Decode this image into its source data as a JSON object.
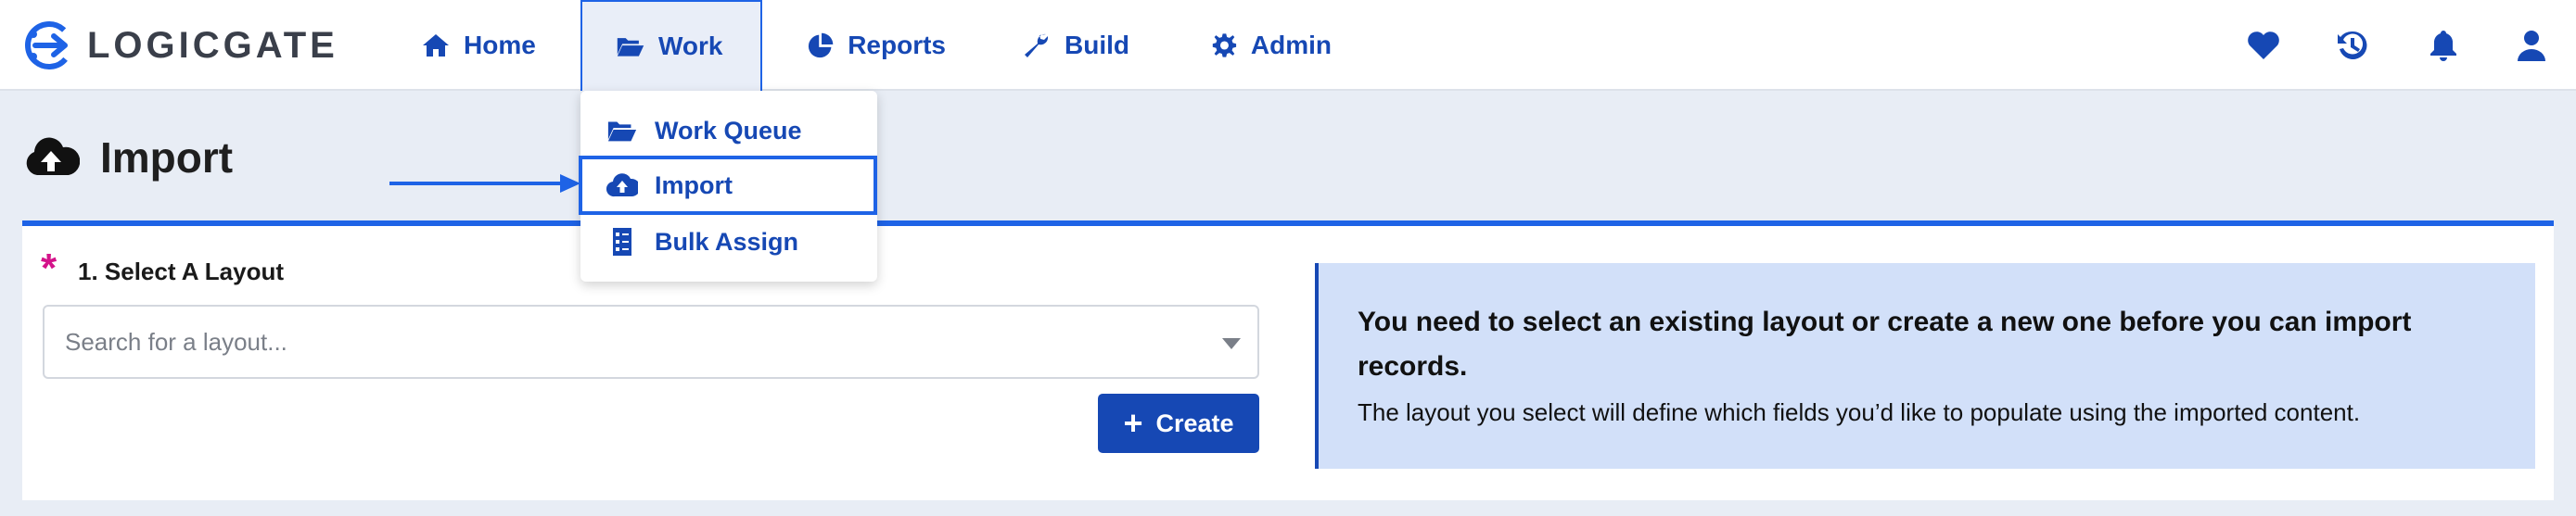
{
  "brand": {
    "logo_text": "LOGICGATE"
  },
  "nav": {
    "home": "Home",
    "work": "Work",
    "reports": "Reports",
    "build": "Build",
    "admin": "Admin"
  },
  "right_icons": [
    "heart-icon",
    "history-icon",
    "bell-icon",
    "user-icon"
  ],
  "work_menu": {
    "items": [
      {
        "label": "Work Queue",
        "icon": "folder-open-icon"
      },
      {
        "label": "Import",
        "icon": "cloud-upload-icon",
        "selected": true
      },
      {
        "label": "Bulk Assign",
        "icon": "checklist-icon"
      }
    ]
  },
  "page": {
    "title": "Import",
    "icon": "cloud-upload-icon"
  },
  "layout_section": {
    "label": "1. Select A Layout",
    "required": true,
    "search_placeholder": "Search for a layout...",
    "create_label": "Create"
  },
  "info": {
    "title": "You need to select an existing layout or create a new one before you can import records.",
    "body": "The layout you select will define which fields you’d like to populate using the imported content."
  },
  "colors": {
    "accent": "#1648b4",
    "highlight_border": "#1e63e6",
    "required_star": "#d4138a",
    "info_bg": "#d2e0f9",
    "page_bg": "#e8edf5"
  }
}
